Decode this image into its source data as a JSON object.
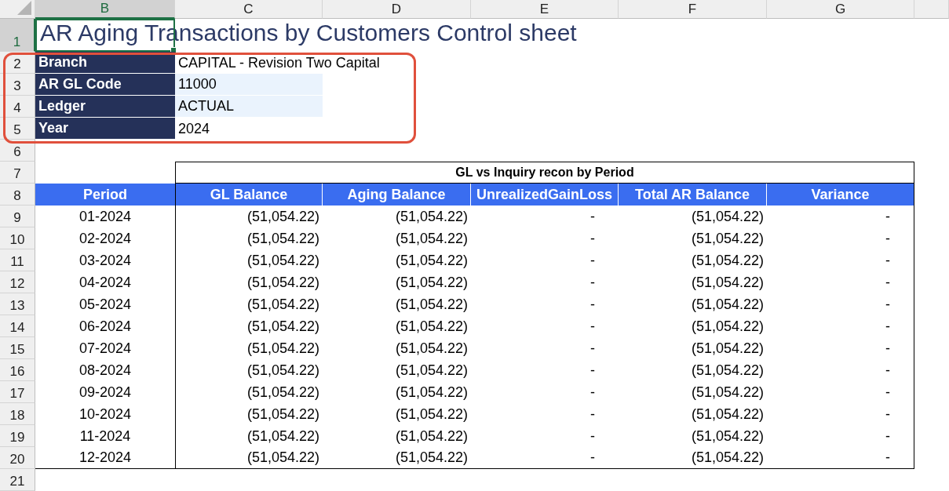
{
  "column_headers": [
    {
      "label": "B",
      "selected": true
    },
    {
      "label": "C",
      "selected": false
    },
    {
      "label": "D",
      "selected": false
    },
    {
      "label": "E",
      "selected": false
    },
    {
      "label": "F",
      "selected": false
    },
    {
      "label": "G",
      "selected": false
    }
  ],
  "row_numbers": [
    {
      "label": "1",
      "selected": true
    },
    {
      "label": "2",
      "selected": false
    },
    {
      "label": "3",
      "selected": false
    },
    {
      "label": "4",
      "selected": false
    },
    {
      "label": "5",
      "selected": false
    },
    {
      "label": "6",
      "selected": false
    },
    {
      "label": "7",
      "selected": false
    },
    {
      "label": "8",
      "selected": false
    },
    {
      "label": "9",
      "selected": false
    },
    {
      "label": "10",
      "selected": false
    },
    {
      "label": "11",
      "selected": false
    },
    {
      "label": "12",
      "selected": false
    },
    {
      "label": "13",
      "selected": false
    },
    {
      "label": "14",
      "selected": false
    },
    {
      "label": "15",
      "selected": false
    },
    {
      "label": "16",
      "selected": false
    },
    {
      "label": "17",
      "selected": false
    },
    {
      "label": "18",
      "selected": false
    },
    {
      "label": "19",
      "selected": false
    },
    {
      "label": "20",
      "selected": false
    },
    {
      "label": "21",
      "selected": false
    }
  ],
  "title": {
    "text": "AR Aging Transactions by Customers Control sheet",
    "selected": true
  },
  "info_rows": [
    {
      "label": "Branch",
      "value": "CAPITAL - Revision Two Capital",
      "shaded": false
    },
    {
      "label": "AR GL Code",
      "value": "11000",
      "shaded": true
    },
    {
      "label": "Ledger",
      "value": "ACTUAL",
      "shaded": true
    },
    {
      "label": "Year",
      "value": "2024",
      "shaded": false
    }
  ],
  "annotation_frame": true,
  "recon_table": {
    "group_title": "GL vs Inquiry recon by Period",
    "columns": [
      "Period",
      "GL Balance",
      "Aging Balance",
      "UnrealizedGainLoss",
      "Total AR Balance",
      "Variance"
    ],
    "rows": [
      [
        "01-2024",
        "(51,054.22)",
        "(51,054.22)",
        "-",
        "(51,054.22)",
        "-"
      ],
      [
        "02-2024",
        "(51,054.22)",
        "(51,054.22)",
        "-",
        "(51,054.22)",
        "-"
      ],
      [
        "03-2024",
        "(51,054.22)",
        "(51,054.22)",
        "-",
        "(51,054.22)",
        "-"
      ],
      [
        "04-2024",
        "(51,054.22)",
        "(51,054.22)",
        "-",
        "(51,054.22)",
        "-"
      ],
      [
        "05-2024",
        "(51,054.22)",
        "(51,054.22)",
        "-",
        "(51,054.22)",
        "-"
      ],
      [
        "06-2024",
        "(51,054.22)",
        "(51,054.22)",
        "-",
        "(51,054.22)",
        "-"
      ],
      [
        "07-2024",
        "(51,054.22)",
        "(51,054.22)",
        "-",
        "(51,054.22)",
        "-"
      ],
      [
        "08-2024",
        "(51,054.22)",
        "(51,054.22)",
        "-",
        "(51,054.22)",
        "-"
      ],
      [
        "09-2024",
        "(51,054.22)",
        "(51,054.22)",
        "-",
        "(51,054.22)",
        "-"
      ],
      [
        "10-2024",
        "(51,054.22)",
        "(51,054.22)",
        "-",
        "(51,054.22)",
        "-"
      ],
      [
        "11-2024",
        "(51,054.22)",
        "(51,054.22)",
        "-",
        "(51,054.22)",
        "-"
      ],
      [
        "12-2024",
        "(51,054.22)",
        "(51,054.22)",
        "-",
        "(51,054.22)",
        "-"
      ]
    ]
  }
}
